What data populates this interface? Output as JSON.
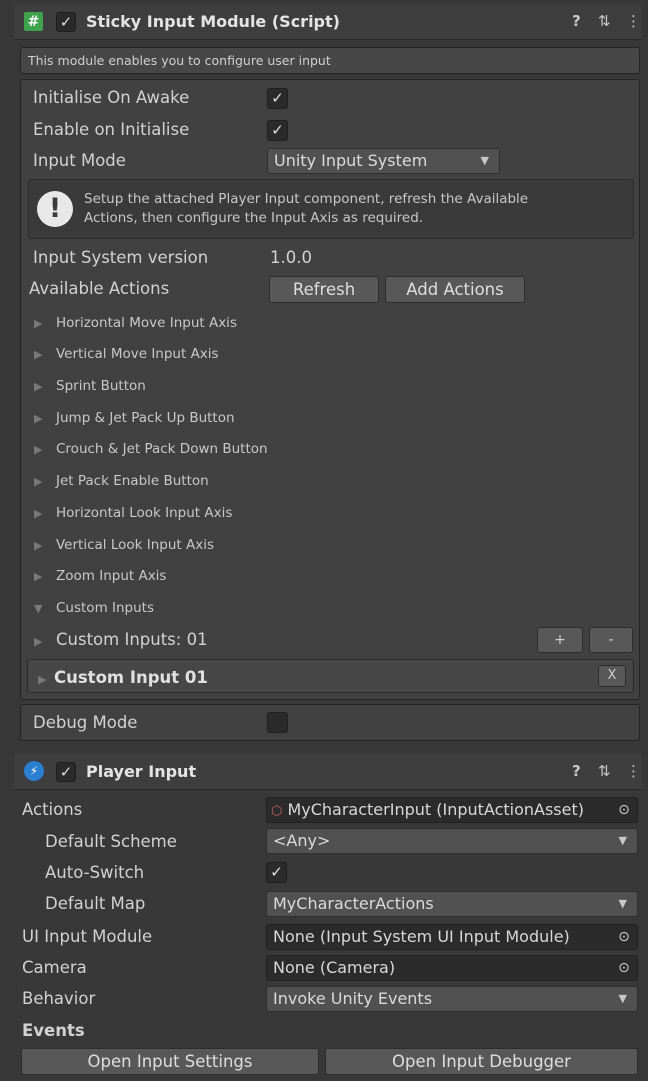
{
  "sticky": {
    "title": "Sticky Input Module (Script)",
    "icon": "hash-script-icon",
    "icon_symbol": "#",
    "help_symbol": "?",
    "presets_symbol": "⇅",
    "more_symbol": "⋮",
    "enabled_symbol": "✓",
    "description": "This module enables you to configure user input",
    "initialise_on_awake_label": "Initialise On Awake",
    "enable_on_initialise_label": "Enable on Initialise",
    "input_mode_label": "Input Mode",
    "input_mode_value": "Unity Input System",
    "check_symbol": "✓",
    "info_icon_symbol": "!",
    "info_line1": "Setup the attached Player Input component, refresh the Available",
    "info_line2": "Actions, then configure the Input Axis as required.",
    "input_system_version_label": "Input System version",
    "input_system_version_value": "1.0.0",
    "available_actions_label": "Available Actions",
    "refresh_label": "Refresh",
    "add_actions_label": "Add Actions",
    "foldouts": [
      "Horizontal Move Input Axis",
      "Vertical Move Input Axis",
      "Sprint Button",
      "Jump & Jet Pack Up Button",
      "Crouch & Jet Pack Down Button",
      "Jet Pack Enable Button",
      "Horizontal Look Input Axis",
      "Vertical Look Input Axis",
      "Zoom Input Axis",
      "Custom Inputs"
    ],
    "custom_inputs_count_label": "Custom Inputs: 01",
    "plus_label": "+",
    "minus_label": "-",
    "custom_input_01_label": "Custom Input 01",
    "remove_label": "X",
    "debug_mode_label": "Debug Mode"
  },
  "player_input": {
    "title": "Player Input",
    "icon": "lightning-icon",
    "icon_symbol": "⚡",
    "help_symbol": "?",
    "presets_symbol": "⇅",
    "more_symbol": "⋮",
    "enabled_symbol": "✓",
    "actions_label": "Actions",
    "actions_value": "MyCharacterInput (InputActionAsset)",
    "default_scheme_label": "Default Scheme",
    "default_scheme_value": "<Any>",
    "auto_switch_label": "Auto-Switch",
    "auto_switch_symbol": "✓",
    "default_map_label": "Default Map",
    "default_map_value": "MyCharacterActions",
    "ui_input_module_label": "UI Input Module",
    "ui_input_module_value": "None (Input System UI Input Module)",
    "camera_label": "Camera",
    "camera_value": "None (Camera)",
    "behavior_label": "Behavior",
    "behavior_value": "Invoke Unity Events",
    "events_label": "Events",
    "open_settings_label": "Open Input Settings",
    "open_debugger_label": "Open Input Debugger",
    "target_symbol": "⊙",
    "dropdown_arrow": "▼",
    "asset_icon_symbol": "⬡"
  }
}
